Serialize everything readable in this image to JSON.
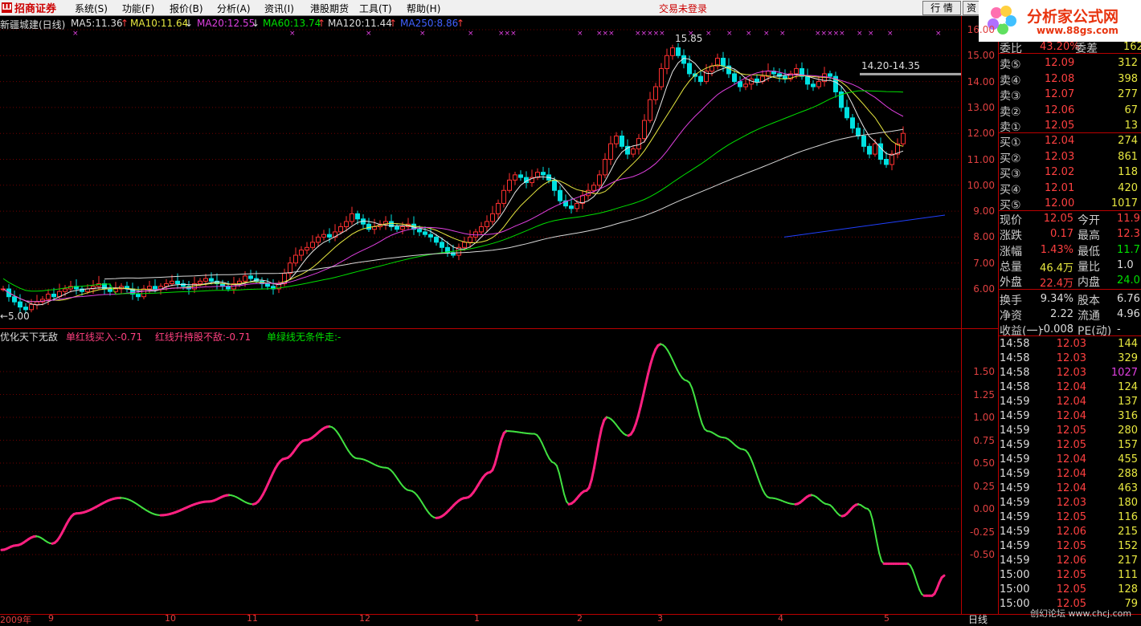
{
  "menu": {
    "logo_text": "招商证券",
    "items": [
      "系统(S)",
      "功能(F)",
      "报价(B)",
      "分析(A)",
      "资讯(I)",
      "港股期货",
      "工具(T)",
      "帮助(H)"
    ],
    "trade_status": "交易未登录",
    "btn_quote": "行 情",
    "btn_trade": "资"
  },
  "watermark": {
    "title": "分析家公式网",
    "url": "www.88gs.com"
  },
  "price_legend": {
    "stock": "新疆城建(日线)",
    "ma5": "MA5:11.36",
    "ma10": "MA10:11.64",
    "ma20": "MA20:12.55",
    "ma60": "MA60:13.74",
    "ma120": "MA120:11.44",
    "ma250": "MA250:8.86",
    "arrow_up": "↑",
    "arrow_down": "↓"
  },
  "price_annotations": {
    "high": "15.85",
    "range": "14.20-14.35",
    "low": "←5.00"
  },
  "indicator_legend": {
    "name": "优化天下无敌",
    "l1": "单红线买入:-0.71",
    "l2": "红线升持股不敌:-0.71",
    "l3": "单绿线无条件走:-"
  },
  "price_axis": [
    "16.00",
    "15.00",
    "14.00",
    "13.00",
    "12.00",
    "11.00",
    "10.00",
    "9.00",
    "8.00",
    "7.00",
    "6.00"
  ],
  "ind_axis": [
    "1.50",
    "1.25",
    "1.00",
    "0.75",
    "0.50",
    "0.25",
    "0.00",
    "-0.25",
    "-0.50"
  ],
  "x_axis": [
    "2009年",
    "9",
    "10",
    "11",
    "12",
    "1",
    "2",
    "3",
    "4",
    "5"
  ],
  "period_label": "日线",
  "order_book": {
    "header": {
      "label": "委比",
      "value": "43.20%",
      "label2": "委差",
      "value2": "162"
    },
    "sells": [
      {
        "label": "卖⑤",
        "price": "12.09",
        "vol": "312"
      },
      {
        "label": "卖④",
        "price": "12.08",
        "vol": "398"
      },
      {
        "label": "卖③",
        "price": "12.07",
        "vol": "277"
      },
      {
        "label": "卖②",
        "price": "12.06",
        "vol": "67"
      },
      {
        "label": "卖①",
        "price": "12.05",
        "vol": "13"
      }
    ],
    "buys": [
      {
        "label": "买①",
        "price": "12.04",
        "vol": "274"
      },
      {
        "label": "买②",
        "price": "12.03",
        "vol": "861"
      },
      {
        "label": "买③",
        "price": "12.02",
        "vol": "118"
      },
      {
        "label": "买④",
        "price": "12.01",
        "vol": "420"
      },
      {
        "label": "买⑤",
        "price": "12.00",
        "vol": "1017"
      }
    ]
  },
  "stats": [
    {
      "l1": "现价",
      "v1": "12.05",
      "l2": "今开",
      "v2": "11.9"
    },
    {
      "l1": "涨跌",
      "v1": "0.17",
      "l2": "最高",
      "v2": "12.3"
    },
    {
      "l1": "涨幅",
      "v1": "1.43%",
      "l2": "最低",
      "v2": "11.7"
    },
    {
      "l1": "总量",
      "v1": "46.4万",
      "l2": "量比",
      "v2": "1.0"
    },
    {
      "l1": "外盘",
      "v1": "22.4万",
      "l2": "内盘",
      "v2": "24.0"
    },
    {
      "l1": "换手",
      "v1": "9.34%",
      "l2": "股本",
      "v2": "6.76"
    },
    {
      "l1": "净资",
      "v1": "2.22",
      "l2": "流通",
      "v2": "4.96"
    },
    {
      "l1": "收益(一)",
      "v1": "-0.008",
      "l2": "PE(动)",
      "v2": "-"
    }
  ],
  "ticks": [
    {
      "t": "14:58",
      "p": "12.03",
      "v": "144"
    },
    {
      "t": "14:58",
      "p": "12.03",
      "v": "329"
    },
    {
      "t": "14:58",
      "p": "12.03",
      "v": "1027"
    },
    {
      "t": "14:58",
      "p": "12.04",
      "v": "124"
    },
    {
      "t": "14:59",
      "p": "12.04",
      "v": "137"
    },
    {
      "t": "14:59",
      "p": "12.04",
      "v": "316"
    },
    {
      "t": "14:59",
      "p": "12.05",
      "v": "280"
    },
    {
      "t": "14:59",
      "p": "12.05",
      "v": "157"
    },
    {
      "t": "14:59",
      "p": "12.04",
      "v": "455"
    },
    {
      "t": "14:59",
      "p": "12.04",
      "v": "288"
    },
    {
      "t": "14:59",
      "p": "12.04",
      "v": "463"
    },
    {
      "t": "14:59",
      "p": "12.03",
      "v": "180"
    },
    {
      "t": "14:59",
      "p": "12.05",
      "v": "116"
    },
    {
      "t": "14:59",
      "p": "12.06",
      "v": "215"
    },
    {
      "t": "14:59",
      "p": "12.05",
      "v": "152"
    },
    {
      "t": "14:59",
      "p": "12.06",
      "v": "217"
    },
    {
      "t": "15:00",
      "p": "12.05",
      "v": "111"
    },
    {
      "t": "15:00",
      "p": "12.05",
      "v": "128"
    },
    {
      "t": "15:00",
      "p": "12.05",
      "v": "79"
    }
  ],
  "footer_credit": "创幻论坛 www.chcj.com",
  "colors": {
    "up": "#ff4040",
    "down": "#00e000",
    "ma5": "#e8e8e8",
    "ma10": "#e8e840",
    "ma20": "#e040e0",
    "ma60": "#00e000",
    "ma120": "#d8d8d8",
    "ma250": "#2040ff",
    "ind_red": "#ff2080",
    "ind_green": "#40e040"
  }
}
